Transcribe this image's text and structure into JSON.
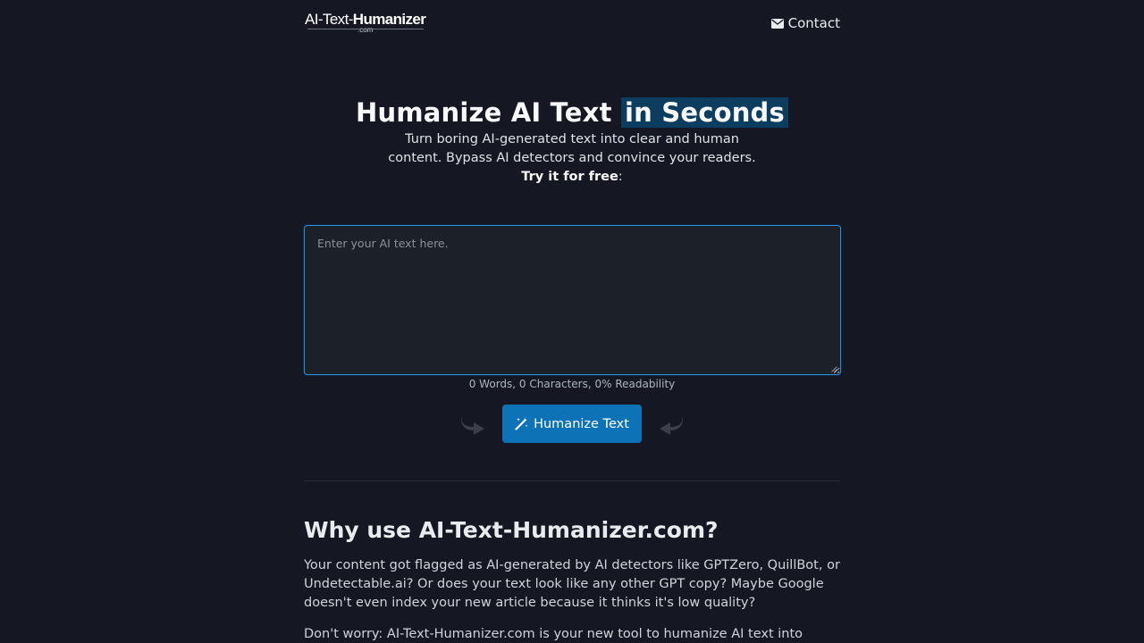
{
  "header": {
    "logo": {
      "main_light": "AI-Text-",
      "main_bold": "Humanizer",
      "sub": ".com"
    },
    "contact_label": "Contact",
    "contact_icon": "envelope-icon"
  },
  "hero": {
    "title_plain": "Humanize AI Text",
    "title_highlight": "in Seconds",
    "subtitle": "Turn boring AI-generated text into clear and human content. Bypass AI detectors and convince your readers.",
    "cta_bold": "Try it for free",
    "cta_suffix": ":"
  },
  "editor": {
    "placeholder": "Enter your AI text here.",
    "value": "",
    "stats": "0 Words, 0 Characters, 0% Readability"
  },
  "actions": {
    "humanize_label": "Humanize Text",
    "humanize_icon": "magic-wand-icon",
    "left_icon": "curved-arrow-right-icon",
    "right_icon": "curved-arrow-left-icon"
  },
  "why": {
    "title": "Why use AI-Text-Humanizer.com?",
    "paragraphs": [
      "Your content got flagged as AI-generated by AI detectors like GPTZero, QuillBot, or Undetectable.ai? Or does your text look like any other GPT copy? Maybe Google doesn't even index your new article because it thinks it's low quality?",
      "Don't worry: AI-Text-Humanizer.com is your new tool to humanize AI text into natural"
    ]
  },
  "colors": {
    "background": "#151822",
    "accent": "#0d73b6",
    "highlight": "#0c3d5e",
    "textarea_border": "#2b8ed6"
  }
}
